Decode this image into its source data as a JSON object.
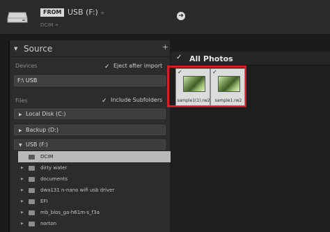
{
  "topbar": {
    "from_badge": "FROM",
    "source_name": "USB (F:)",
    "source_caret": "÷",
    "source_path": "DCIM ÷",
    "arrow_icon": "arrow-right-icon"
  },
  "source_panel": {
    "title": "Source",
    "add_label": "+",
    "devices_label": "Devices",
    "eject_label": "Eject after import",
    "eject_checked": true,
    "device_value": "F:\\ USB",
    "files_label": "Files",
    "subfolders_label": "Include Subfolders",
    "subfolders_checked": true,
    "volumes": [
      {
        "label": "Local Disk (C:)",
        "expanded": false
      },
      {
        "label": "Backup (D:)",
        "expanded": false
      },
      {
        "label": "USB (F:)",
        "expanded": true
      }
    ],
    "folders": [
      {
        "label": "DCIM",
        "selected": true
      },
      {
        "label": "dirty water",
        "selected": false
      },
      {
        "label": "documents",
        "selected": false
      },
      {
        "label": "dwa131 n-nano wifi usb driver",
        "selected": false
      },
      {
        "label": "EFI",
        "selected": false
      },
      {
        "label": "mb_bios_ga-h61m-s_f3a",
        "selected": false
      },
      {
        "label": "norton",
        "selected": false
      }
    ]
  },
  "grid": {
    "header_title": "All Photos",
    "header_checked": true,
    "photos": [
      {
        "filename": "sample1(1).rw2",
        "checked": true
      },
      {
        "filename": "sample1.rw2",
        "checked": true
      }
    ]
  },
  "colors": {
    "highlight": "#d21f25",
    "selected_row": "#b9b9b9"
  }
}
